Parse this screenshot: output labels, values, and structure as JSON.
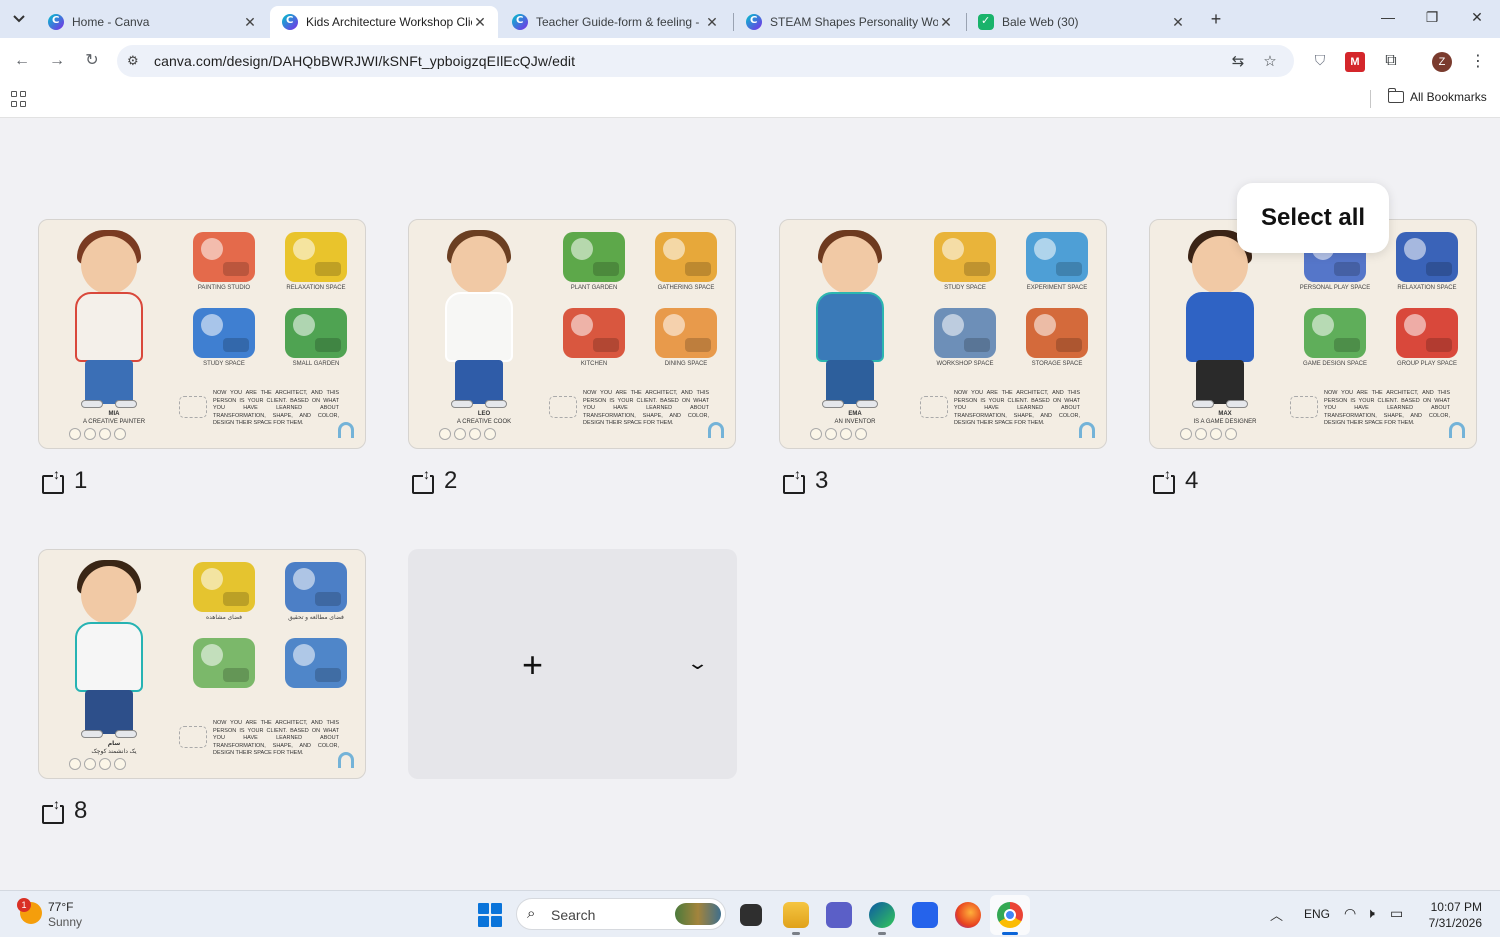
{
  "browser": {
    "tabs": [
      {
        "title": "Home - Canva",
        "favicon": "canva-icon",
        "active": false
      },
      {
        "title": "Kids Architecture Workshop Clie",
        "favicon": "canva-icon",
        "active": true
      },
      {
        "title": "Teacher Guide-form & feeling -",
        "favicon": "canva-icon",
        "active": false
      },
      {
        "title": "STEAM Shapes Personality Worl",
        "favicon": "canva-icon",
        "active": false
      },
      {
        "title": "Bale Web (30)",
        "favicon": "bale-icon",
        "active": false
      }
    ],
    "url": "canva.com/design/DAHQbBWRJWI/kSNFt_ypboigzqEIlEcQJw/edit",
    "bookmarks_label": "All Bookmarks",
    "profile_initial": "Z"
  },
  "pages": [
    {
      "number": "1",
      "character_name": "MIA",
      "character_role": "A CREATIVE PAINTER",
      "colors": {
        "hair": "#7a3b22",
        "body": "#f4f0ea",
        "legs": "#3b6fb6",
        "accent": "#d9483b"
      },
      "spaces": [
        {
          "label": "PAINTING STUDIO",
          "color": "#e46a4b"
        },
        {
          "label": "RELAXATION SPACE",
          "color": "#e9c42c"
        },
        {
          "label": "STUDY SPACE",
          "color": "#3f7fd1"
        },
        {
          "label": "SMALL GARDEN",
          "color": "#4fa352"
        }
      ]
    },
    {
      "number": "2",
      "character_name": "LEO",
      "character_role": "A CREATIVE COOK",
      "colors": {
        "hair": "#6b3f22",
        "body": "#f7f7f5",
        "legs": "#2f5ca8",
        "accent": "#ffffff"
      },
      "spaces": [
        {
          "label": "PLANT GARDEN",
          "color": "#5da84a"
        },
        {
          "label": "GATHERING SPACE",
          "color": "#e7a83a"
        },
        {
          "label": "KITCHEN",
          "color": "#d9573f"
        },
        {
          "label": "DINING SPACE",
          "color": "#e89a4b"
        }
      ]
    },
    {
      "number": "3",
      "character_name": "EMA",
      "character_role": "AN INVENTOR",
      "colors": {
        "hair": "#6e3a1f",
        "body": "#3a7ab8",
        "legs": "#2d5f9c",
        "accent": "#2cb6b0"
      },
      "spaces": [
        {
          "label": "STUDY SPACE",
          "color": "#e9b43a"
        },
        {
          "label": "EXPERIMENT SPACE",
          "color": "#4e9fd6"
        },
        {
          "label": "WORKSHOP SPACE",
          "color": "#6d8fb8"
        },
        {
          "label": "STORAGE SPACE",
          "color": "#d46a3b"
        }
      ]
    },
    {
      "number": "4",
      "character_name": "MAX",
      "character_role": "IS A GAME DESIGNER",
      "colors": {
        "hair": "#3b2416",
        "body": "#2f63c4",
        "legs": "#2a2a2a",
        "accent": "#2f63c4"
      },
      "spaces": [
        {
          "label": "PERSONAL PLAY SPACE",
          "color": "#5576c9"
        },
        {
          "label": "RELAXATION SPACE",
          "color": "#3a63b8"
        },
        {
          "label": "GAME DESIGN SPACE",
          "color": "#5fae5a"
        },
        {
          "label": "GROUP PLAY SPACE",
          "color": "#d9483b"
        }
      ]
    },
    {
      "number": "8",
      "character_name": "سام",
      "character_role": "یک دانشمند کوچک",
      "colors": {
        "hair": "#3a2616",
        "body": "#f6f6f6",
        "legs": "#2d4f8a",
        "accent": "#26b3b3"
      },
      "spaces": [
        {
          "label": "فضای مشاهده",
          "color": "#e5c42f"
        },
        {
          "label": "فضای مطالعه و تحقیق",
          "color": "#4c7fc6"
        },
        {
          "label": "",
          "color": "#7bb86a"
        },
        {
          "label": "",
          "color": "#4f86c9"
        }
      ]
    }
  ],
  "instructions_text": "NOW YOU ARE THE ARCHITECT, AND THIS PERSON IS YOUR CLIENT. BASED ON WHAT YOU HAVE LEARNED ABOUT TRANSFORMATION, SHAPE, AND COLOR, DESIGN THEIR SPACE FOR THEM.",
  "select_all_label": "Select all",
  "taskbar": {
    "weather_temp": "77°F",
    "weather_condition": "Sunny",
    "weather_badge": "1",
    "search_placeholder": "Search",
    "language": "ENG",
    "time": "10:07 PM",
    "date": "7/31/2026"
  }
}
